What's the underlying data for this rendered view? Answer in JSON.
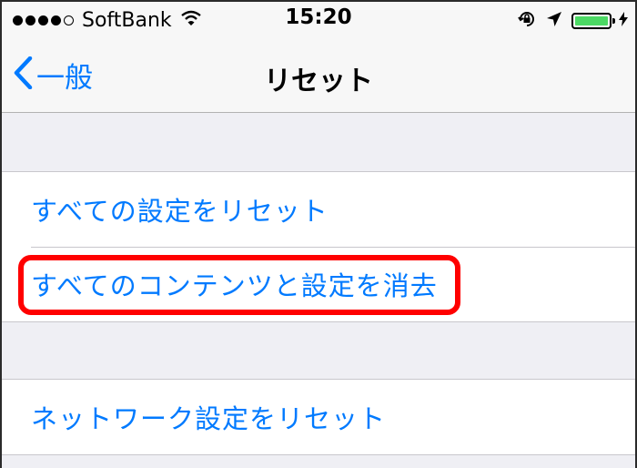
{
  "status_bar": {
    "carrier": "SoftBank",
    "time": "15:20",
    "signal_icon": "signal-dots-icon",
    "wifi_icon": "wifi-icon",
    "rotation_lock_icon": "rotation-lock-icon",
    "location_icon": "location-arrow-icon",
    "battery_icon": "battery-icon",
    "charging_icon": "charging-bolt-icon",
    "battery_level": 1.0,
    "battery_color": "#4cd964"
  },
  "nav": {
    "back_label": "一般",
    "back_icon": "chevron-left-icon",
    "title": "リセット"
  },
  "groups": [
    {
      "items": [
        "すべての設定をリセット",
        "すべてのコンテンツと設定を消去"
      ]
    },
    {
      "items": [
        "ネットワーク設定をリセット"
      ]
    }
  ],
  "highlighted_item": "すべてのコンテンツと設定を消去",
  "colors": {
    "accent": "#007aff",
    "highlight": "#ff0000",
    "background": "#efeff4"
  }
}
